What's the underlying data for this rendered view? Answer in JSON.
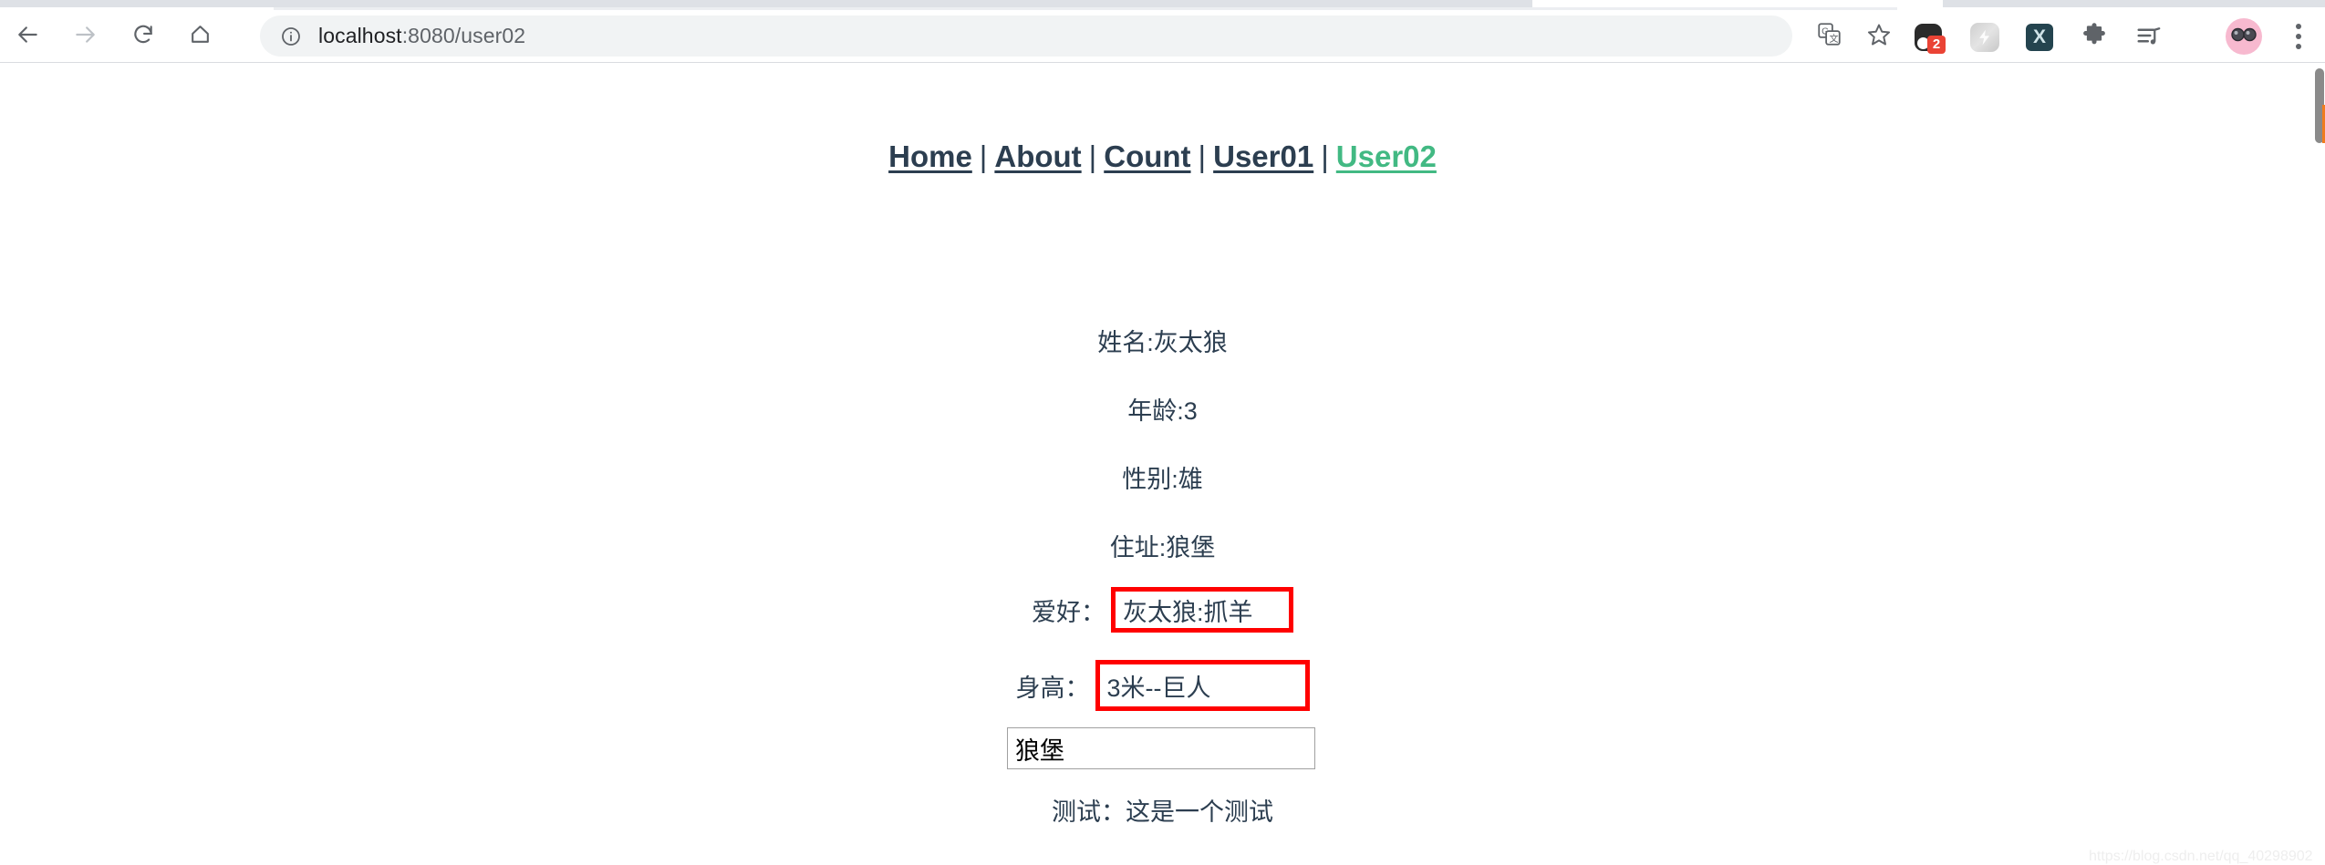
{
  "browser": {
    "back_icon": "arrow-left-icon",
    "forward_icon": "arrow-right-icon",
    "reload_icon": "reload-icon",
    "home_icon": "home-icon",
    "omnibox": {
      "info_icon": "info-circle-icon",
      "host": "localhost",
      "path": ":8080/user02",
      "full_url": "localhost:8080/user02"
    },
    "translate_icon": "translate-icon",
    "bookmark_icon": "star-outline-icon",
    "extensions": [
      {
        "name": "dark-rounded-extension-icon",
        "badge": "2"
      },
      {
        "name": "lightning-bolt-extension-icon",
        "badge": ""
      },
      {
        "name": "x-letter-extension-icon",
        "label": "X",
        "badge": ""
      },
      {
        "name": "puzzle-piece-extensions-icon",
        "badge": ""
      },
      {
        "name": "music-playlist-icon",
        "badge": ""
      }
    ],
    "avatar_icon": "sunglasses-avatar-icon",
    "menu_icon": "three-dot-menu-icon"
  },
  "page": {
    "nav": {
      "separator": "|",
      "links": [
        {
          "label": "Home",
          "active": false
        },
        {
          "label": "About",
          "active": false
        },
        {
          "label": "Count",
          "active": false
        },
        {
          "label": "User01",
          "active": false
        },
        {
          "label": "User02",
          "active": true
        }
      ],
      "active_color": "#42b983",
      "text_color": "#2c3e50"
    },
    "details": {
      "name": "姓名:灰太狼",
      "age": "年龄:3",
      "gender": "性别:雄",
      "address": "住址:狼堡"
    },
    "hobby": {
      "label": "爱好：",
      "value": "灰太狼:抓羊",
      "highlight_color": "#ff0000"
    },
    "height": {
      "label": "身高：",
      "value": "3米--巨人",
      "highlight_color": "#ff0000"
    },
    "address_input": {
      "value": "狼堡",
      "placeholder": ""
    },
    "test_line": "测试：这是一个测试",
    "watermark": "https://blog.csdn.net/qq_40298902"
  }
}
